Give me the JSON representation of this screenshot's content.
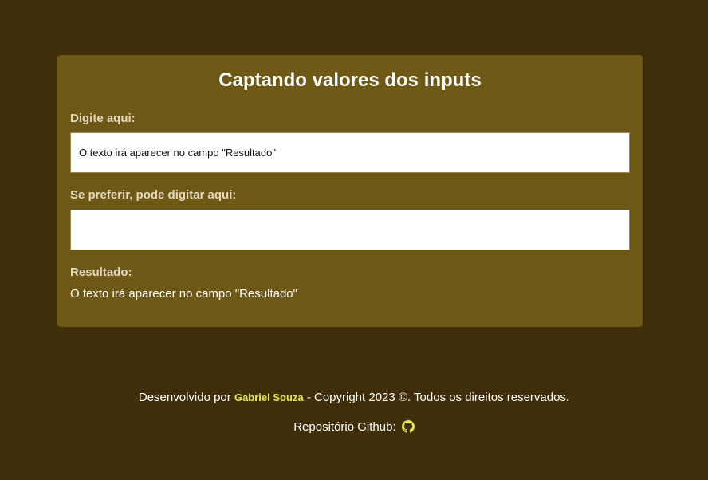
{
  "card": {
    "title": "Captando valores dos inputs",
    "field1": {
      "label": "Digite aqui:",
      "value": "O texto irá aparecer no campo \"Resultado\""
    },
    "field2": {
      "label": "Se preferir, pode digitar aqui:",
      "value": ""
    },
    "result": {
      "label": "Resultado:",
      "text": "O texto irá aparecer no campo \"Resultado\""
    }
  },
  "footer": {
    "prefix": "Desenvolvido por ",
    "author": "Gabriel Souza",
    "suffix": " - Copyright 2023 ©. Todos os direitos reservados.",
    "repo_label": "Repositório Github: "
  },
  "colors": {
    "background": "#3f2e09",
    "card": "#6e5815",
    "accent": "#e8e84a"
  },
  "icons": {
    "github": "github-icon"
  }
}
